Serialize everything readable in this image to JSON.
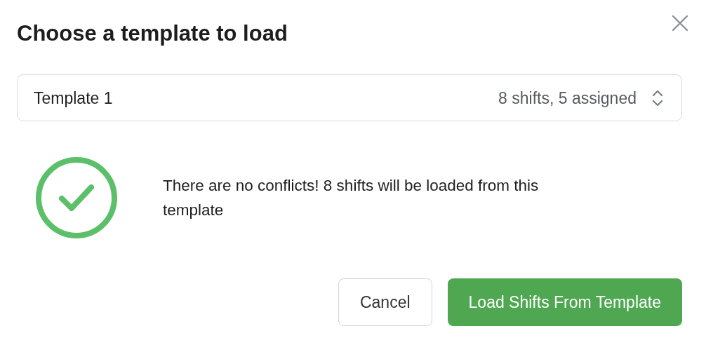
{
  "dialog": {
    "title": "Choose a template to load"
  },
  "template_select": {
    "value": "Template 1",
    "detail": "8 shifts, 5 assigned"
  },
  "result": {
    "kind": "success",
    "message": "There are no conflicts! 8 shifts will be loaded from this template"
  },
  "buttons": [
    {
      "label": "Cancel",
      "kind": "secondary"
    },
    {
      "label": "Load Shifts From Template",
      "kind": "primary"
    }
  ]
}
